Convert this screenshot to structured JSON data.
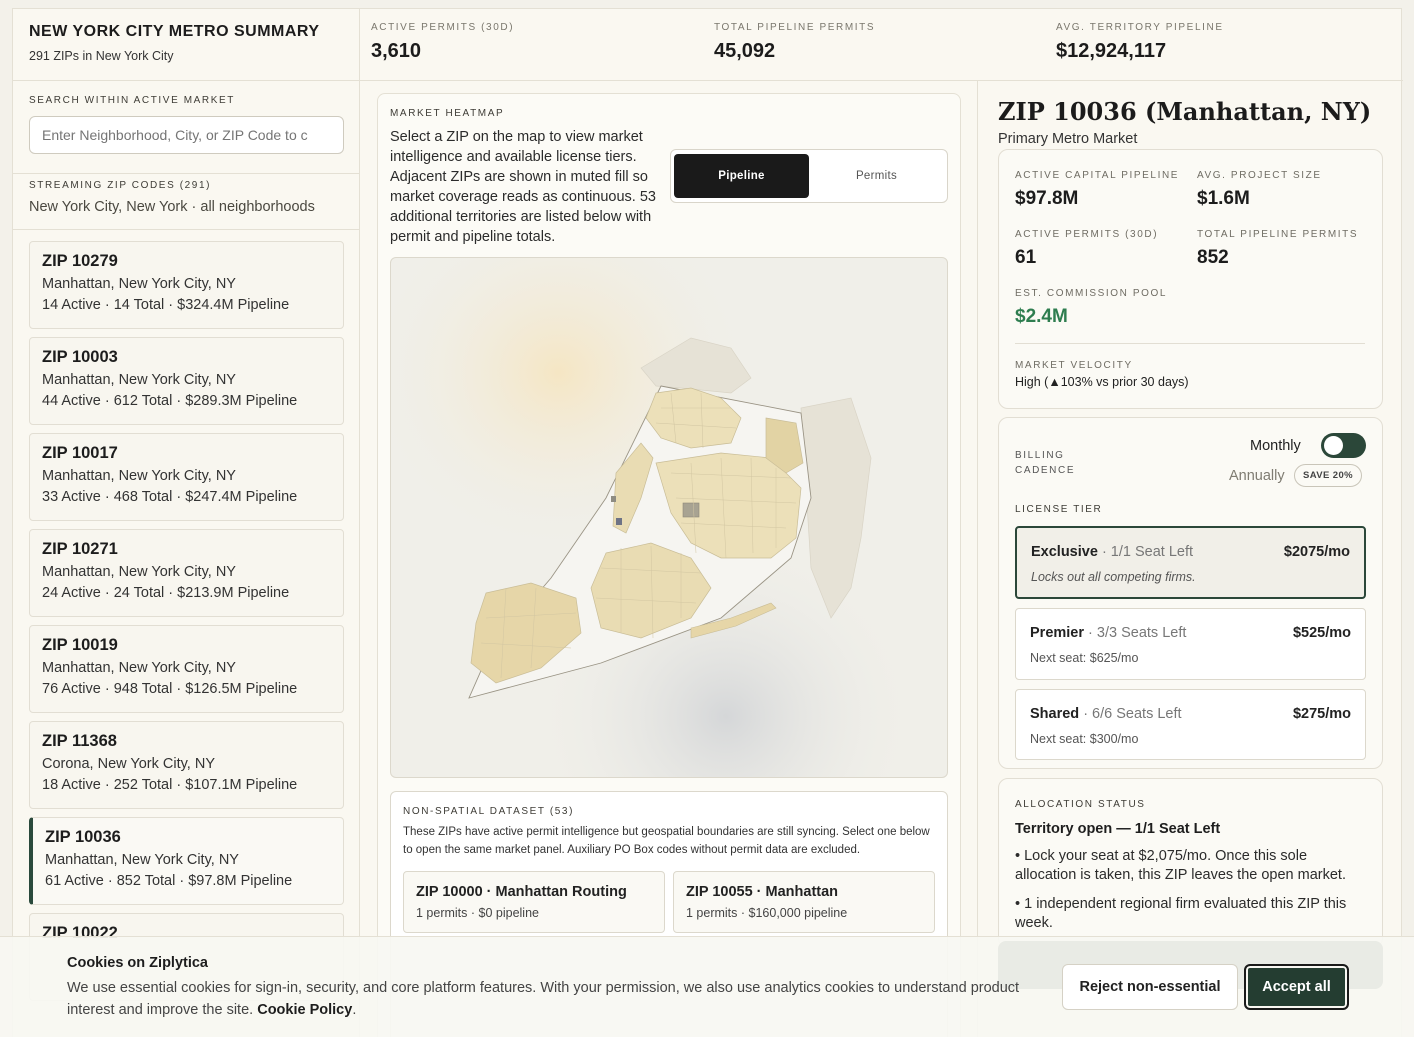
{
  "header": {
    "title": "NEW YORK CITY METRO SUMMARY",
    "subtitle": "291 ZIPs in New York City",
    "stats": [
      {
        "label": "ACTIVE PERMITS (30D)",
        "value": "3,610"
      },
      {
        "label": "TOTAL PIPELINE PERMITS",
        "value": "45,092"
      },
      {
        "label": "AVG. TERRITORY PIPELINE",
        "value": "$12,924,117"
      }
    ]
  },
  "sidebar": {
    "search_label": "SEARCH WITHIN ACTIVE MARKET",
    "search_placeholder": "Enter Neighborhood, City, or ZIP Code to c",
    "streaming_label": "STREAMING ZIP CODES (291)",
    "streaming_sub": "New York City, New York · all neighborhoods",
    "zips": [
      {
        "title": "ZIP 10279",
        "location": "Manhattan, New York City, NY",
        "stats": "14 Active · 14 Total · $324.4M Pipeline"
      },
      {
        "title": "ZIP 10003",
        "location": "Manhattan, New York City, NY",
        "stats": "44 Active · 612 Total · $289.3M Pipeline"
      },
      {
        "title": "ZIP 10017",
        "location": "Manhattan, New York City, NY",
        "stats": "33 Active · 468 Total · $247.4M Pipeline"
      },
      {
        "title": "ZIP 10271",
        "location": "Manhattan, New York City, NY",
        "stats": "24 Active · 24 Total · $213.9M Pipeline"
      },
      {
        "title": "ZIP 10019",
        "location": "Manhattan, New York City, NY",
        "stats": "76 Active · 948 Total · $126.5M Pipeline"
      },
      {
        "title": "ZIP 11368",
        "location": "Corona, New York City, NY",
        "stats": "18 Active · 252 Total · $107.1M Pipeline"
      },
      {
        "title": "ZIP 10036",
        "location": "Manhattan, New York City, NY",
        "stats": "61 Active · 852 Total · $97.8M Pipeline"
      },
      {
        "title": "ZIP 10022",
        "location": "",
        "stats": ""
      }
    ]
  },
  "center": {
    "heatmap_label": "MARKET HEATMAP",
    "heatmap_text": "Select a ZIP on the map to view market intelligence and available license tiers. Adjacent ZIPs are shown in muted fill so market coverage reads as continuous. 53 additional territories are listed below with permit and pipeline totals.",
    "toggle": {
      "pipeline": "Pipeline",
      "permits": "Permits",
      "selected": "Pipeline"
    },
    "nsd_label": "NON-SPATIAL DATASET (53)",
    "nsd_text": "These ZIPs have active permit intelligence but geospatial boundaries are still syncing. Select one below to open the same market panel. Auxiliary PO Box codes without permit data are excluded.",
    "nsd_items": [
      {
        "title": "ZIP 10000 · Manhattan Routing",
        "sub": "1 permits · $0 pipeline"
      },
      {
        "title": "ZIP 10055 · Manhattan",
        "sub": "1 permits · $160,000 pipeline"
      }
    ]
  },
  "detail": {
    "title": "ZIP 10036 (Manhattan, NY)",
    "subtitle": "Primary Metro Market",
    "metrics": [
      {
        "label": "ACTIVE CAPITAL PIPELINE",
        "value": "$97.8M"
      },
      {
        "label": "AVG. PROJECT SIZE",
        "value": "$1.6M"
      },
      {
        "label": "ACTIVE PERMITS (30D)",
        "value": "61"
      },
      {
        "label": "TOTAL PIPELINE PERMITS",
        "value": "852"
      },
      {
        "label": "EST. COMMISSION POOL",
        "value": "$2.4M"
      }
    ],
    "velocity_label": "MARKET VELOCITY",
    "velocity_value": "High (▲103% vs prior 30 days)",
    "billing": {
      "label_line1": "BILLING",
      "label_line2": "CADENCE",
      "monthly": "Monthly",
      "annually": "Annually",
      "save_badge": "SAVE 20%"
    },
    "license_label": "LICENSE TIER",
    "tiers": [
      {
        "name": "Exclusive",
        "seats": " · 1/1 Seat Left",
        "price": "$2075/mo",
        "note": "Locks out all competing firms."
      },
      {
        "name": "Premier",
        "seats": " · 3/3 Seats Left",
        "price": "$525/mo",
        "note": "Next seat: $625/mo"
      },
      {
        "name": "Shared",
        "seats": " · 6/6 Seats Left",
        "price": "$275/mo",
        "note": "Next seat: $300/mo"
      }
    ],
    "allocation": {
      "label": "ALLOCATION STATUS",
      "title": "Territory open — 1/1 Seat Left",
      "bullets": [
        "• Lock your seat at $2,075/mo. Once this sole allocation is taken, this ZIP leaves the open market.",
        "• 1 independent regional firm evaluated this ZIP this week."
      ]
    }
  },
  "cookie": {
    "title": "Cookies on Ziplytica",
    "text": "We use essential cookies for sign-in, security, and core platform features. With your permission, we also use analytics cookies to understand product interest and improve the site.",
    "link": "Cookie Policy",
    "reject": "Reject non-essential",
    "accept": "Accept all"
  },
  "colors": {
    "accent": "#2b4739",
    "commission": "#2e7d4f",
    "page_bg": "#faf8f1"
  }
}
